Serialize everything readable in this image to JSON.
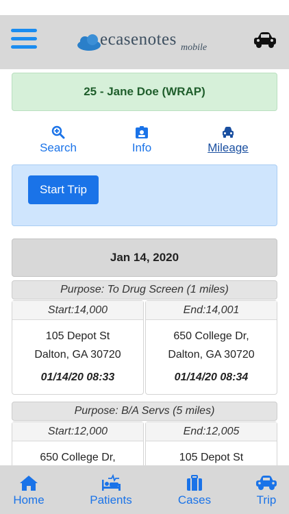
{
  "header": {
    "logo_text": "ecasenotes",
    "logo_sub": "mobile",
    "menu_icon": "hamburger-menu-icon",
    "car_icon": "car-icon"
  },
  "client": {
    "label": "25 - Jane Doe (WRAP)",
    "color": "#1f5e2c"
  },
  "nav": {
    "search": "Search",
    "info": "Info",
    "mileage": "Mileage"
  },
  "trip": {
    "start_label": "Start Trip"
  },
  "date_header": "Jan 14, 2020",
  "trips": [
    {
      "purpose": "Purpose: To Drug Screen   (1 miles)",
      "start": {
        "odometer": "Start:14,000",
        "line1": "105 Depot St",
        "line2": "Dalton, GA 30720",
        "time": "01/14/20 08:33"
      },
      "end": {
        "odometer": "End:14,001",
        "line1": "650 College Dr,",
        "line2": "Dalton, GA 30720",
        "time": "01/14/20 08:34"
      }
    },
    {
      "purpose": "Purpose: B/A Servs   (5 miles)",
      "start": {
        "odometer": "Start:12,000",
        "line1": "650 College Dr,",
        "line2": "",
        "time": ""
      },
      "end": {
        "odometer": "End:12,005",
        "line1": "105 Depot St",
        "line2": "",
        "time": ""
      }
    }
  ],
  "tabs": {
    "home": "Home",
    "patients": "Patients",
    "cases": "Cases",
    "trip": "Trip"
  },
  "colors": {
    "accent": "#1a73e8",
    "bar": "#d8d8d8",
    "trip_panel": "#cfe5fd",
    "client_banner": "#d6f0d9"
  }
}
